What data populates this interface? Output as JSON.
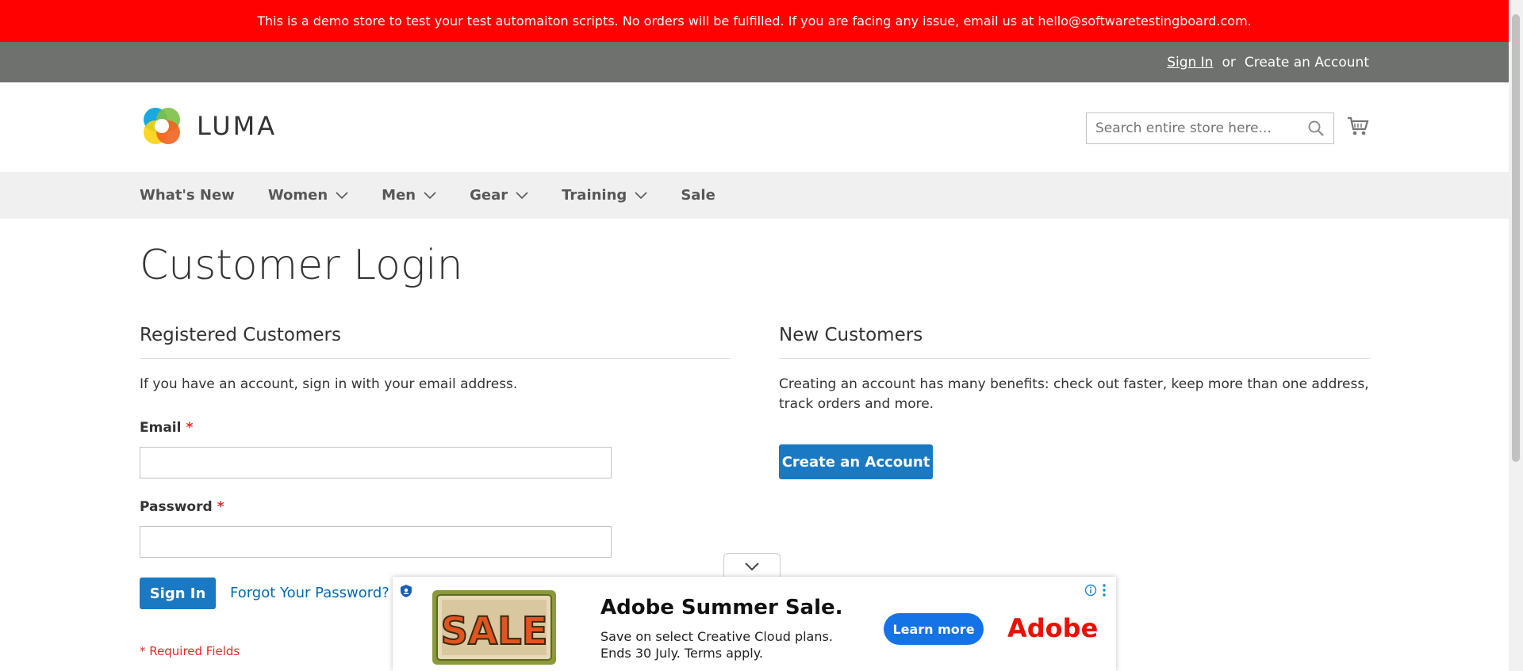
{
  "notice": "This is a demo store to test your test automaiton scripts. No orders will be fulfilled. If you are facing any issue, email us at hello@softwaretestingboard.com.",
  "panel": {
    "sign_in": "Sign In",
    "or": "or",
    "create_account": "Create an Account"
  },
  "logo": {
    "text": "LUMA"
  },
  "search": {
    "placeholder": "Search entire store here..."
  },
  "nav": {
    "items": [
      {
        "label": "What's New"
      },
      {
        "label": "Women"
      },
      {
        "label": "Men"
      },
      {
        "label": "Gear"
      },
      {
        "label": "Training"
      },
      {
        "label": "Sale"
      }
    ]
  },
  "page_title": "Customer Login",
  "registered": {
    "heading": "Registered Customers",
    "intro": "If you have an account, sign in with your email address.",
    "email_label": "Email",
    "password_label": "Password",
    "required_mark": "*",
    "sign_in_button": "Sign In",
    "forgot_link": "Forgot Your Password?",
    "required_note": "* Required Fields"
  },
  "new_customers": {
    "heading": "New Customers",
    "text": "Creating an account has many benefits: check out faster, keep more than one address, track orders and more.",
    "button": "Create an Account"
  },
  "ad": {
    "image_text": "SALE",
    "headline": "Adobe Summer Sale.",
    "body": "Save on select Creative Cloud plans. Ends 30 July. Terms apply.",
    "cta": "Learn more",
    "brand": "Adobe"
  },
  "colors": {
    "notice_bg": "#ff0101",
    "panel_bg": "#6e716e",
    "nav_bg": "#f0f0f0",
    "primary_button": "#1979c3",
    "link": "#006bb4",
    "required": "#e02b27",
    "ad_cta": "#1473e6",
    "ad_brand": "#eb1000"
  }
}
